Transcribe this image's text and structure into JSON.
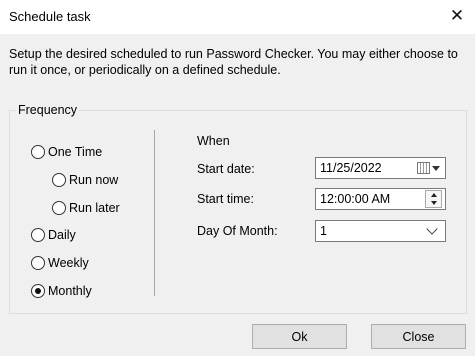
{
  "window": {
    "title": "Schedule task",
    "close_glyph": "✕"
  },
  "description": "Setup the desired scheduled to run Password Checker. You may either choose to run it once, or periodically on a defined schedule.",
  "frequency": {
    "legend": "Frequency",
    "options": {
      "one_time": "One Time",
      "run_now": "Run now",
      "run_later": "Run later",
      "daily": "Daily",
      "weekly": "Weekly",
      "monthly": "Monthly"
    },
    "selected": "Monthly"
  },
  "when": {
    "heading": "When",
    "start_date_label": "Start date:",
    "start_date_value": "11/25/2022",
    "start_time_label": "Start time:",
    "start_time_value": "12:00:00 AM",
    "day_of_month_label": "Day Of Month:",
    "day_of_month_value": "1"
  },
  "buttons": {
    "ok": "Ok",
    "close": "Close"
  },
  "icons": {
    "close": "close-icon",
    "calendar": "calendar-icon",
    "dropdown": "chevron-down-icon",
    "spinner": "spinner-arrows-icon"
  }
}
